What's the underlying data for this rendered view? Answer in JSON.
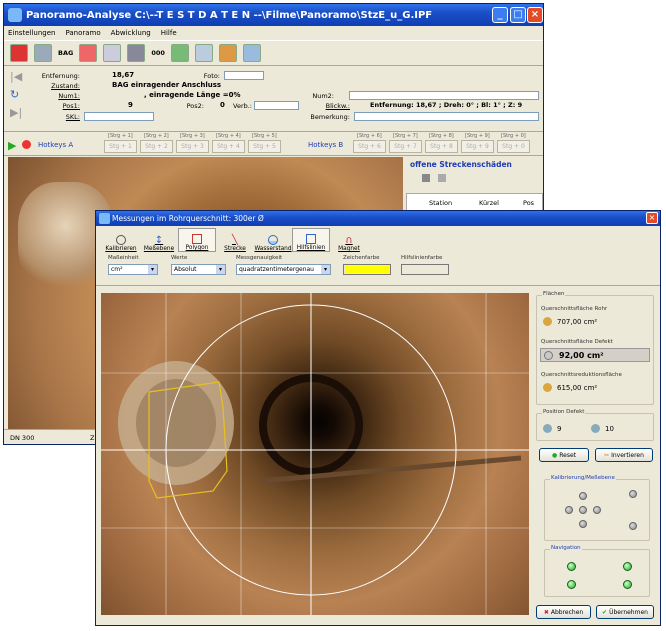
{
  "main_window": {
    "title": "Panoramo-Analyse    C:\\--T E S T D A T E N --\\Filme\\Panoramo\\StzE_u_G.IPF",
    "menu": [
      "Einstellungen",
      "Panoramo",
      "Abwicklung",
      "Hilfe"
    ],
    "toolbar": {
      "bag_label": "BAG",
      "counter_label": "000"
    },
    "fields": {
      "entfernung_label": "Entfernung:",
      "entfernung_value": "18,67",
      "foto_label": "Foto:",
      "zustand_label": "Zustand:",
      "zustand_value": "BAG  einragender Anschluss",
      "num1_label": "Num1:",
      "num1_value": ", einragende Länge =0%",
      "num2_label": "Num2:",
      "pos1_label": "Pos1:",
      "pos1_value": "9",
      "pos2_label": "Pos2:",
      "pos2_value": "0",
      "verb_label": "Verb.:",
      "blickw_label": "Blickw.:",
      "blickw_value": "Entfernung: 18,67 ; Dreh: 0° ; Bl: 1° ; Z: 9",
      "skl_label": "SKL:",
      "bemerkung_label": "Bemerkung:"
    },
    "hotkeys": {
      "a_label": "Hotkeys A",
      "b_label": "Hotkeys B",
      "a_keys": [
        "[Strg + 1]",
        "[Strg + 2]",
        "[Strg + 3]",
        "[Strg + 4]",
        "[Strg + 5]"
      ],
      "a_buttons": [
        "Stg + 1",
        "Stg + 2",
        "Stg + 3",
        "Stg + 4",
        "Stg + 5"
      ],
      "b_keys": [
        "[Strg + 6]",
        "[Strg + 7]",
        "[Strg + 8]",
        "[Strg + 9]",
        "[Strg + 0]"
      ],
      "b_buttons": [
        "Stg + 6",
        "Stg + 7",
        "Stg + 8",
        "Stg + 9",
        "Stg + 0"
      ]
    },
    "damage_panel": {
      "title": "offene Streckenschäden",
      "columns": [
        "Station",
        "Kürzel",
        "Pos"
      ]
    },
    "status": {
      "dn": "DN 300",
      "z": "Z"
    }
  },
  "dialog": {
    "title": "Messungen im Rohrquerschnitt: 300er Ø",
    "tools": [
      "Kalibrieren",
      "Meßebene",
      "Polygon",
      "Strecke",
      "Wasserstand",
      "Hilfslinien",
      "Magnet"
    ],
    "options": {
      "masseinheit_label": "Maßeinheit",
      "masseinheit_value": "cm²",
      "werte_label": "Werte",
      "werte_value": "Absolut",
      "messgenauigkeit_label": "Messgenauigkeit",
      "messgenauigkeit_value": "quadratzentimetergenau",
      "zeichenfarbe_label": "Zeichenfarbe",
      "hilfslinienfarbe_label": "Hilfslinienfarbe"
    },
    "flaechen": {
      "title": "Flächen",
      "rohr_label": "Querschnittsfläche Rohr",
      "rohr_value": "707,00 cm²",
      "defekt_label": "Querschnittsfläche Defekt",
      "defekt_value": "92,00 cm²",
      "reduktion_label": "Querschnittsreduktionsfläche",
      "reduktion_value": "615,00 cm²"
    },
    "position": {
      "title": "Position Defekt",
      "pos1": "9",
      "pos2": "10"
    },
    "buttons": {
      "reset": "Reset",
      "invert": "Invertieren",
      "cancel": "Abbrechen",
      "apply": "Übernehmen"
    },
    "groups": {
      "kalibrierung": "Kalibrierung/Meßebene",
      "navigation": "Navigation"
    }
  },
  "colors": {
    "zeichenfarbe": "#ffff00",
    "accent": "#1e3cb5"
  }
}
